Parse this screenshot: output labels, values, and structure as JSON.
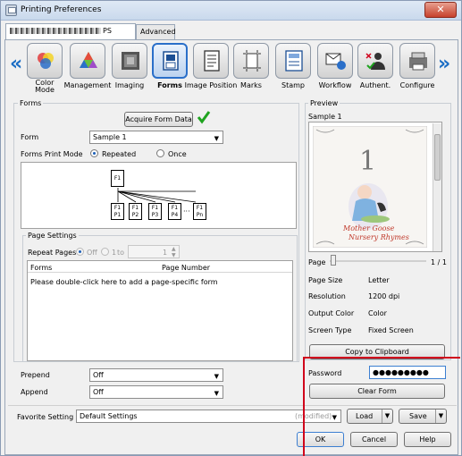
{
  "window": {
    "title": "Printing Preferences",
    "close": "✕"
  },
  "tabs": [
    {
      "label": "PS",
      "masked_prefix": true
    },
    {
      "label": "Advanced"
    }
  ],
  "toolbar": {
    "left_arrow": "«",
    "right_arrow": "»",
    "items": [
      {
        "label": "Color\nMode",
        "icon": "color-circles-icon"
      },
      {
        "label": "Management",
        "icon": "palette-icon"
      },
      {
        "label": "Imaging",
        "icon": "imaging-icon"
      },
      {
        "label": "Forms",
        "icon": "forms-icon",
        "active": true
      },
      {
        "label": "Image Position",
        "icon": "page-position-icon"
      },
      {
        "label": "Marks",
        "icon": "crop-marks-icon"
      },
      {
        "label": "Stamp",
        "icon": "stamp-icon"
      },
      {
        "label": "Workflow",
        "icon": "workflow-icon"
      },
      {
        "label": "Authent.",
        "icon": "authentication-icon"
      },
      {
        "label": "Configure",
        "icon": "printer-configure-icon"
      }
    ]
  },
  "forms": {
    "group_label": "Forms",
    "acquire_button": "Acquire Form Data",
    "form_label": "Form",
    "form_value": "Sample 1",
    "print_mode_label": "Forms Print Mode",
    "mode_repeated": "Repeated",
    "mode_once": "Once",
    "diagram": {
      "top": "F1",
      "pages": [
        "F1\nP1",
        "F1\nP2",
        "F1\nP3",
        "F1\nP4",
        "F1\nPn"
      ],
      "ellipsis": "···"
    }
  },
  "page_settings": {
    "group_label": "Page Settings",
    "repeat_label": "Repeat Pages",
    "off_label": "Off",
    "range_from": "1",
    "range_to_label": "to",
    "range_to": "1",
    "columns": [
      "Forms",
      "Page Number"
    ],
    "hint": "Please double-click here to add a page-specific form"
  },
  "prepend": {
    "label": "Prepend",
    "value": "Off"
  },
  "append": {
    "label": "Append",
    "value": "Off"
  },
  "preview": {
    "group_label": "Preview",
    "sample_name": "Sample 1",
    "art": {
      "number": "1",
      "caption1": "Mother Goose",
      "caption2": "Nursery Rhymes"
    },
    "page_label": "Page",
    "page_count": "1 / 1",
    "info": [
      {
        "label": "Page Size",
        "value": "Letter"
      },
      {
        "label": "Resolution",
        "value": "1200 dpi"
      },
      {
        "label": "Output Color",
        "value": "Color"
      },
      {
        "label": "Screen Type",
        "value": "Fixed Screen"
      }
    ],
    "copy_button": "Copy to Clipboard"
  },
  "password": {
    "label": "Password",
    "value": "●●●●●●●●●",
    "clear_button": "Clear Form"
  },
  "favorite": {
    "label": "Favorite Setting",
    "value": "Default Settings",
    "modified": "(modified)",
    "load": "Load",
    "save": "Save"
  },
  "footer": {
    "ok": "OK",
    "cancel": "Cancel",
    "help": "Help"
  },
  "colors": {
    "accent": "#1a6dc4",
    "highlight": "#d0021b",
    "check": "#1fa31f"
  }
}
